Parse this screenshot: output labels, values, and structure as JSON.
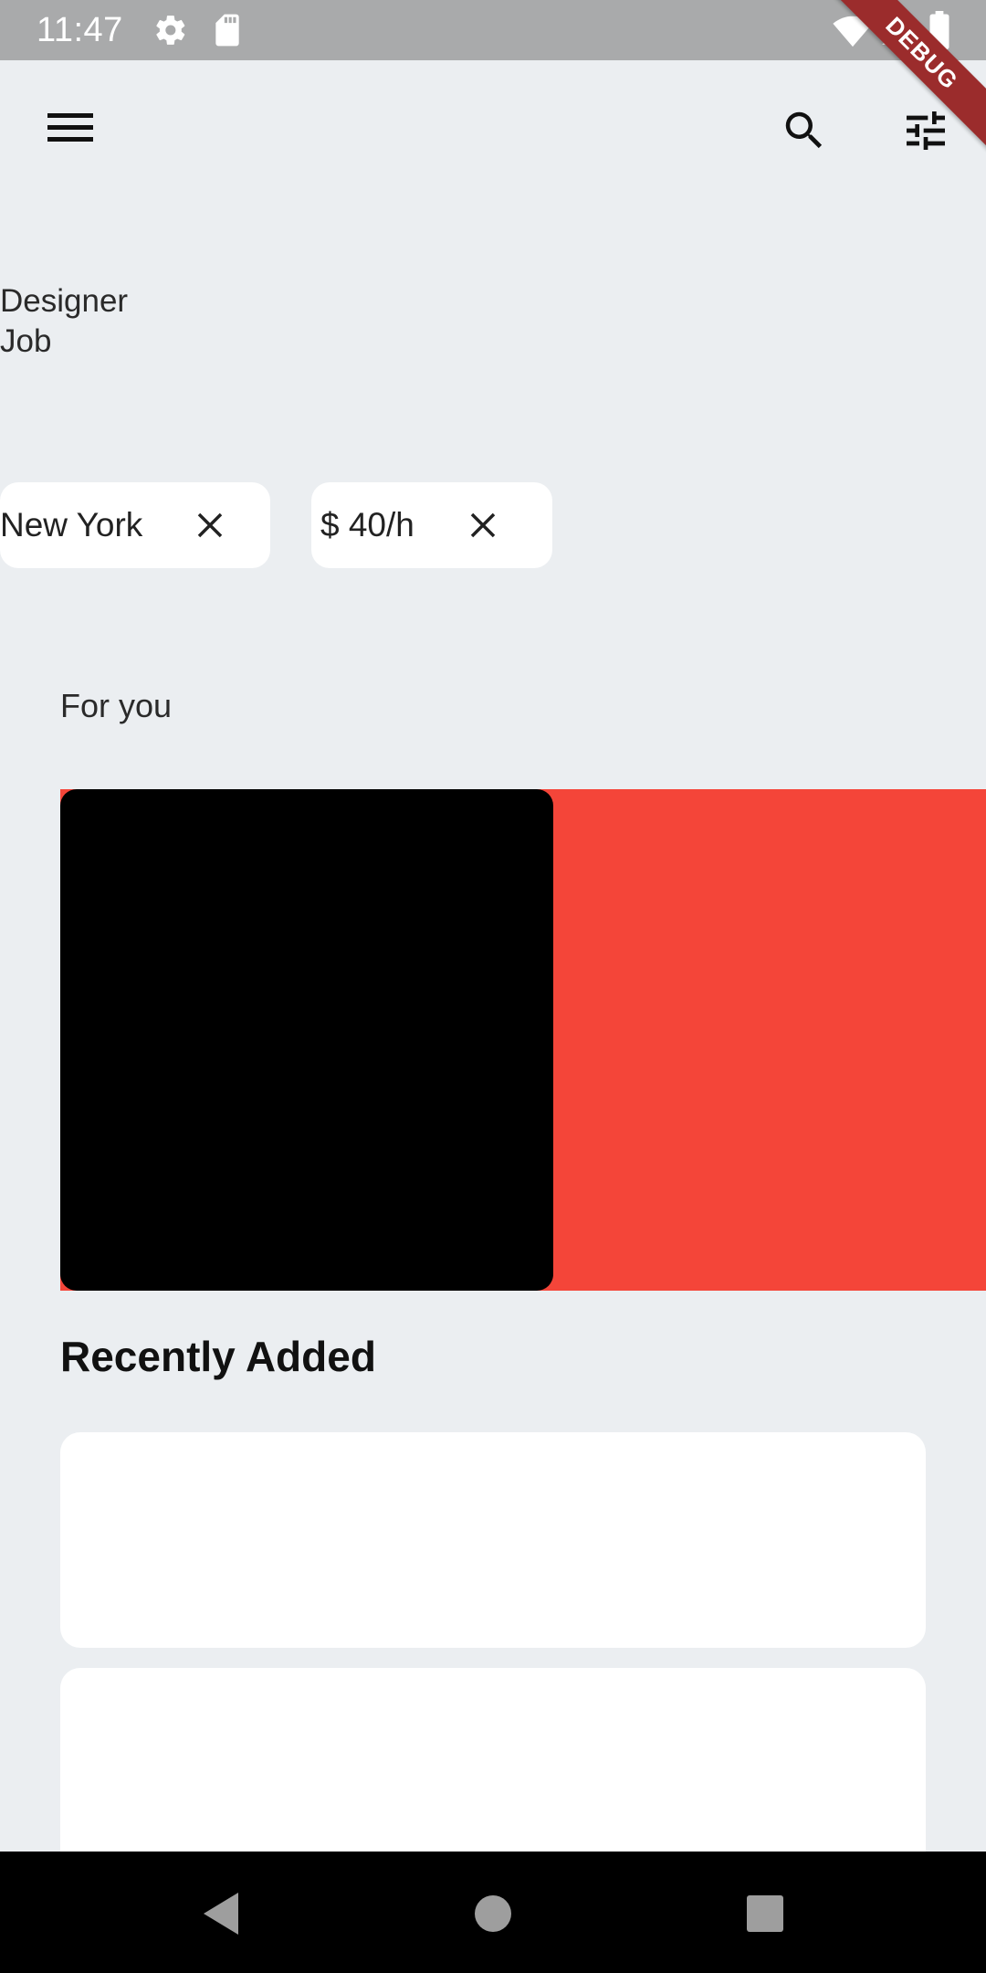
{
  "status_bar": {
    "time": "11:47",
    "icons": [
      "gear-icon",
      "sd-card-icon",
      "wifi-icon",
      "signal-icon",
      "battery-icon"
    ],
    "background": "#a9aaab"
  },
  "debug_banner": {
    "label": "DEBUG",
    "color": "#9b2c2c"
  },
  "app_bar": {
    "menu_icon": "menu-icon",
    "search_icon": "search-icon",
    "filter_icon": "tune-icon"
  },
  "title": {
    "line1": "Designer",
    "line2": "Job"
  },
  "chips": [
    {
      "label": "New York",
      "close_icon": "close-icon"
    },
    {
      "label": "$ 40/h",
      "close_icon": "close-icon"
    }
  ],
  "sections": {
    "for_you": "For you",
    "recently_added": "Recently Added"
  },
  "colors": {
    "background": "#ebeef1",
    "carousel_accent": "#f44539",
    "card_dark": "#000000",
    "card_light": "#ffffff"
  },
  "nav_bar": {
    "back_icon": "back-triangle-icon",
    "home_icon": "home-circle-icon",
    "recents_icon": "recents-square-icon"
  }
}
